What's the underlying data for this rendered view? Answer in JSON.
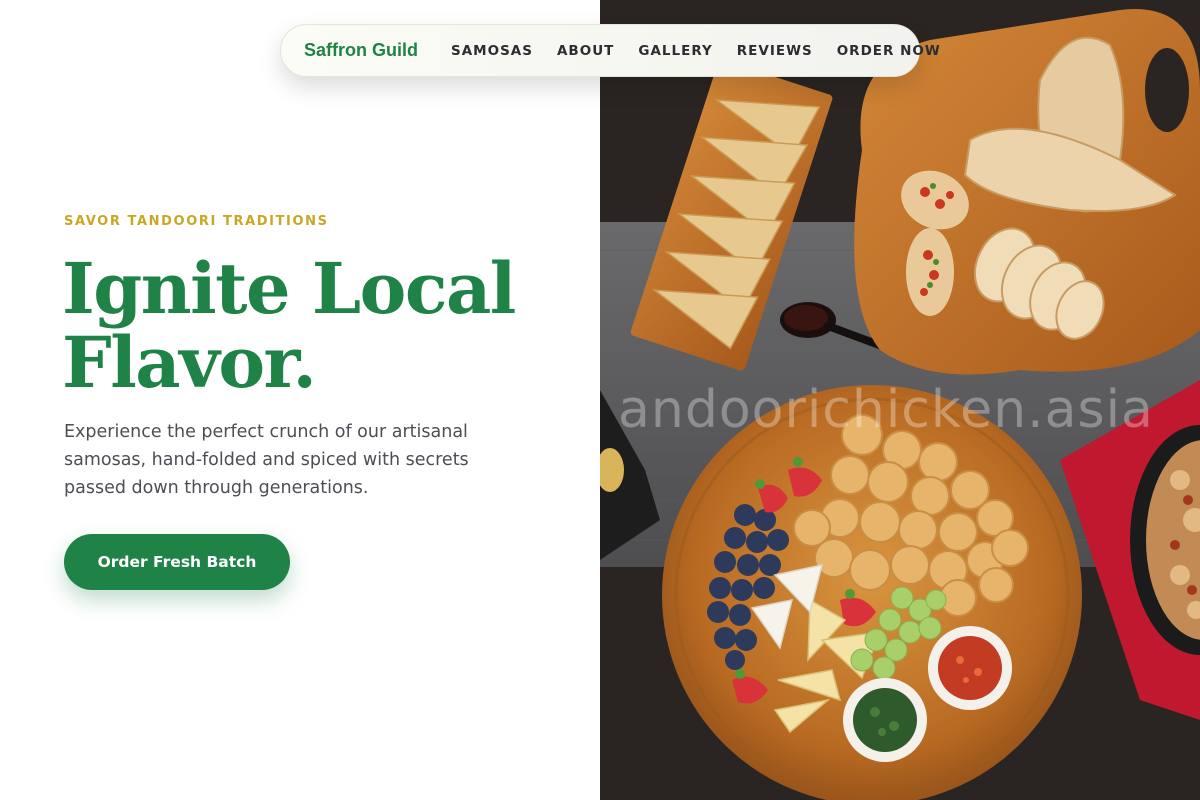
{
  "brand": {
    "name": "Saffron Guild"
  },
  "nav": {
    "links": [
      {
        "label": "SAMOSAS"
      },
      {
        "label": "ABOUT"
      },
      {
        "label": "GALLERY"
      },
      {
        "label": "REVIEWS"
      },
      {
        "label": "ORDER NOW"
      }
    ]
  },
  "hero": {
    "eyebrow": "SAVOR TANDOORI TRADITIONS",
    "title_line1": "Ignite Local",
    "title_line2": "Flavor.",
    "description": "Experience the perfect crunch of our artisanal samosas, hand-folded and spiced with secrets passed down through generations.",
    "cta_label": "Order Fresh Batch"
  },
  "image": {
    "watermark": "andoorichicken.asia"
  },
  "colors": {
    "brand_green": "#1f8247",
    "eyebrow_gold": "#c8a822",
    "body_text": "#4c4e55",
    "nav_text": "#2a2d31"
  }
}
